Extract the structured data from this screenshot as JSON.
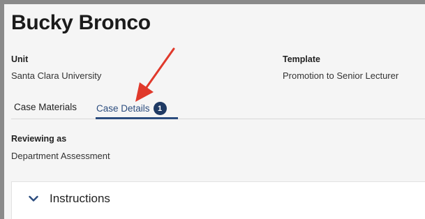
{
  "case": {
    "name": "Bucky Bronco"
  },
  "meta": {
    "unit_label": "Unit",
    "unit_value": "Santa Clara University",
    "template_label": "Template",
    "template_value": "Promotion to Senior Lecturer"
  },
  "tabs": [
    {
      "label": "Case Materials",
      "active": false
    },
    {
      "label": "Case Details",
      "active": true,
      "badge": "1"
    }
  ],
  "reviewing": {
    "label": "Reviewing as",
    "value": "Department Assessment"
  },
  "panel": {
    "title": "Instructions",
    "icon": "chevron-down-icon"
  },
  "annotation": {
    "icon": "red-arrow-icon",
    "color": "#e0392b"
  },
  "colors": {
    "accent": "#2b4c7e",
    "badge_bg": "#1f3a64"
  }
}
